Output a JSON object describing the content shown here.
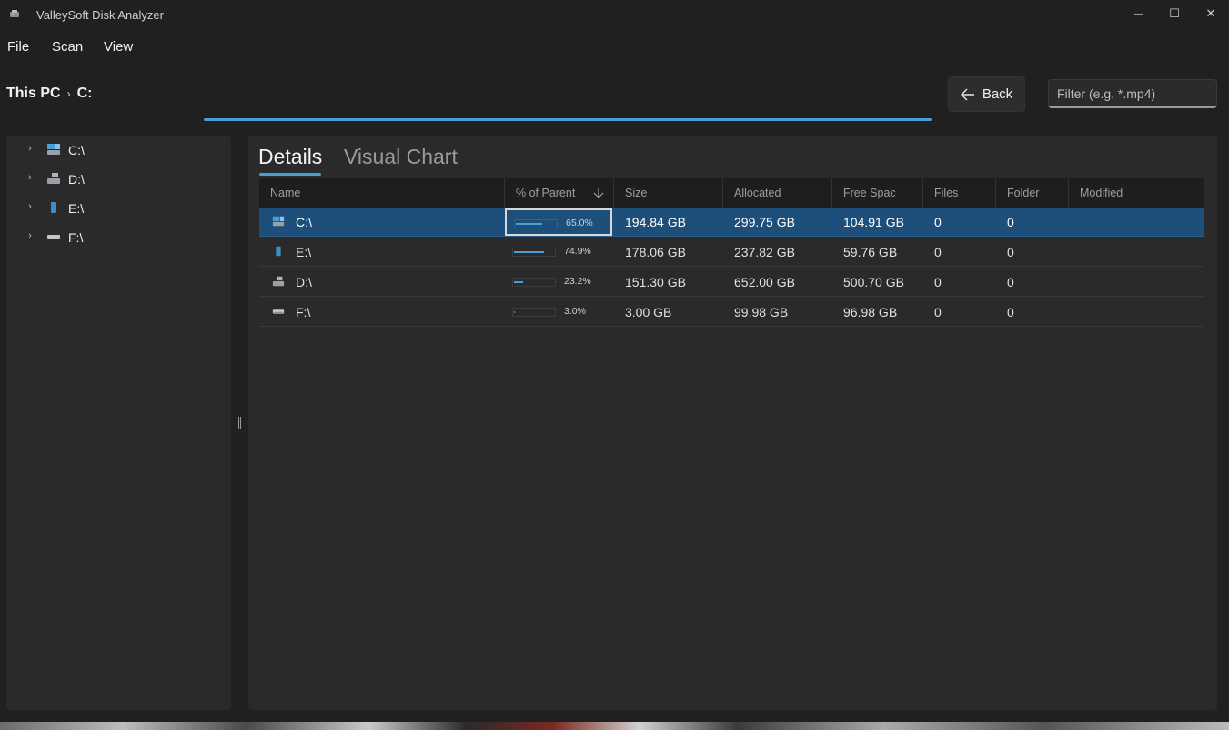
{
  "window": {
    "title": "ValleySoft Disk Analyzer",
    "minimize_glyph": "—",
    "maximize_glyph": "☐",
    "close_glyph": "✕"
  },
  "menu": [
    "File",
    "Scan",
    "View"
  ],
  "breadcrumb": [
    "This PC",
    "C:"
  ],
  "breadcrumb_separator": "›",
  "back_button": {
    "label": "Back",
    "icon": "arrow-left-icon"
  },
  "filter": {
    "placeholder": "Filter (e.g. *.mp4)",
    "value": ""
  },
  "scan_progress": 1.0,
  "tree": [
    {
      "label": "C:\\",
      "icon": "system-drive-icon"
    },
    {
      "label": "D:\\",
      "icon": "hard-drive-icon"
    },
    {
      "label": "E:\\",
      "icon": "usb-drive-icon"
    },
    {
      "label": "F:\\",
      "icon": "removable-drive-icon"
    }
  ],
  "tabs": [
    "Details",
    "Visual Chart"
  ],
  "active_tab": "Details",
  "columns": [
    "Name",
    "% of Parent",
    "Size",
    "Allocated",
    "Free Spac",
    "Files",
    "Folder",
    "Modified"
  ],
  "sort": {
    "column": "% of Parent",
    "direction": "descending"
  },
  "rows": [
    {
      "name": "C:\\",
      "icon": "system-drive-icon",
      "pct": "65.0%",
      "pct_value": 0.65,
      "size": "194.84 GB",
      "allocated": "299.75 GB",
      "free": "104.91 GB",
      "files": "0",
      "folders": "0",
      "modified": "",
      "selected": true
    },
    {
      "name": "E:\\",
      "icon": "usb-drive-icon",
      "pct": "74.9%",
      "pct_value": 0.749,
      "size": "178.06 GB",
      "allocated": "237.82 GB",
      "free": "59.76 GB",
      "files": "0",
      "folders": "0",
      "modified": "",
      "selected": false
    },
    {
      "name": "D:\\",
      "icon": "hard-drive-icon",
      "pct": "23.2%",
      "pct_value": 0.232,
      "size": "151.30 GB",
      "allocated": "652.00 GB",
      "free": "500.70 GB",
      "files": "0",
      "folders": "0",
      "modified": "",
      "selected": false
    },
    {
      "name": "F:\\",
      "icon": "removable-drive-icon",
      "pct": "3.0%",
      "pct_value": 0.03,
      "size": "3.00 GB",
      "allocated": "99.98 GB",
      "free": "96.98 GB",
      "files": "0",
      "folders": "0",
      "modified": "",
      "selected": false
    }
  ],
  "colors": {
    "accent": "#4a9ed8",
    "selection": "#1d4f7a",
    "background": "#202020",
    "pane": "#2a2a2a"
  }
}
